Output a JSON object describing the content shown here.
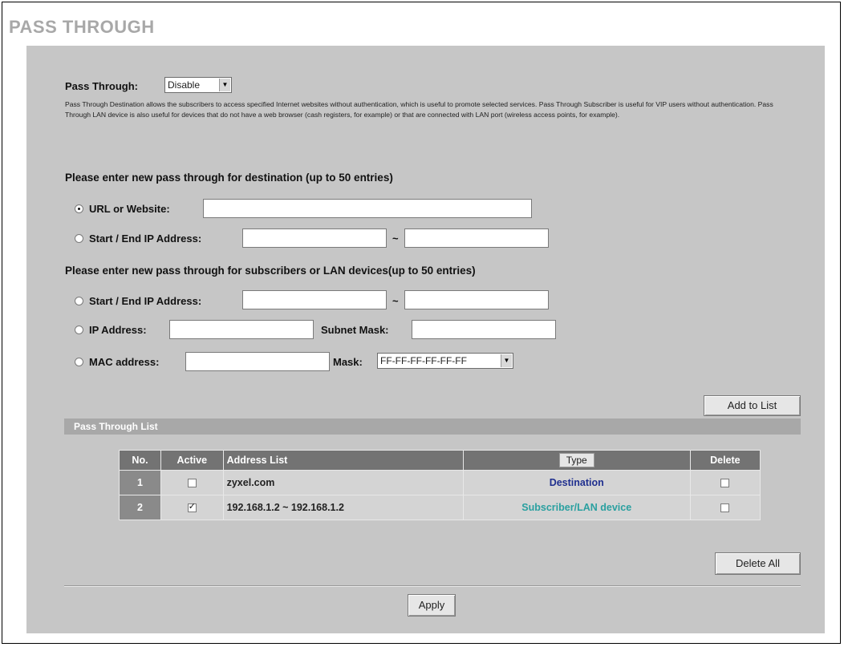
{
  "page": {
    "title": "PASS THROUGH"
  },
  "pass_through": {
    "label": "Pass Through:",
    "selected": "Disable",
    "description": "Pass Through Destination allows the subscribers to access specified Internet websites without authentication, which is useful to promote selected services. Pass Through Subscriber is useful for VIP users without authentication. Pass Through LAN device is also useful for devices that do not have a web browser (cash registers, for example) or that are connected with LAN port (wireless access points, for example)."
  },
  "destination": {
    "heading": "Please enter new pass through for destination (up to 50 entries)",
    "url_label": "URL or Website:",
    "url_value": "",
    "ip_range_label": "Start / End IP Address:",
    "start_ip": "",
    "end_ip": "",
    "separator": "~"
  },
  "subscribers": {
    "heading": "Please enter new pass through for subscribers or LAN devices(up to 50 entries)",
    "ip_range_label": "Start / End IP Address:",
    "separator": "~",
    "ip_label": "IP Address:",
    "subnet_label": "Subnet Mask:",
    "mac_label": "MAC address:",
    "mask_label": "Mask:",
    "mask_selected": "FF-FF-FF-FF-FF-FF"
  },
  "buttons": {
    "add_to_list": "Add to List",
    "delete_all": "Delete All",
    "apply": "Apply"
  },
  "list": {
    "section_title": "Pass Through List",
    "columns": [
      "No.",
      "Active",
      "Address List",
      "Type",
      "Delete"
    ],
    "rows": [
      {
        "no": "1",
        "active": false,
        "address": "zyxel.com",
        "type": "Destination",
        "type_color": "#1f2f8f",
        "delete": false
      },
      {
        "no": "2",
        "active": true,
        "address": "192.168.1.2  ~ 192.168.1.2",
        "type": "Subscriber/LAN device",
        "type_color": "#2aa0a0",
        "delete": false
      }
    ]
  },
  "icons": [
    "dropdown-arrow-icon",
    "radio-icon",
    "checkbox-icon"
  ]
}
